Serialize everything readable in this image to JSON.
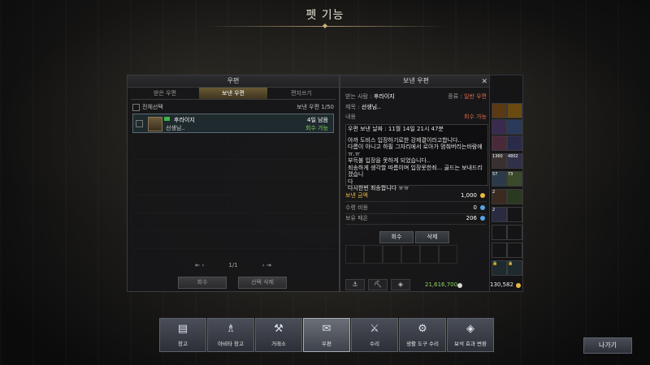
{
  "page_title": "펫 기능",
  "mail_panel": {
    "title": "우편",
    "tabs": [
      {
        "label": "받은 우편"
      },
      {
        "label": "보낸 우편"
      },
      {
        "label": "편지쓰기"
      }
    ],
    "select_all_label": "전체선택",
    "count_label": "보낸 우편 1/50",
    "items": [
      {
        "sender": "후라이지",
        "subject": "선생님..",
        "days_left": "4일 남음",
        "status": "회수 가능"
      }
    ],
    "pager": {
      "prev": "⇤ ‹",
      "page": "1/1",
      "next": "› ⇥"
    },
    "buttons": {
      "recall": "회수",
      "delete_selected": "선택 삭제"
    }
  },
  "detail_panel": {
    "title": "보낸 우편",
    "recipient_label": "받는 사람 :",
    "recipient": "후라이지",
    "type_label": "종류 :",
    "type_value": "일반 우편",
    "subject_label": "제목 :",
    "subject": "선생님..",
    "content_label": "내용",
    "recall_status": "회수 가능",
    "date_line": "우편 보낸 날짜 : 11월 14일 21시 47분",
    "body_lines": [
      "아까 도비스 입장하기로한 강제결이라고합니다..",
      "다름이 아니고 하필 그자리에서 로아가 멈춰버리는바람에 ㅠ.ㅠ",
      "부득불 입장을 못하게 되었습니다..",
      "죄송하게 생각할 따름이며 입장못한죄... 골드는 보내드리겠습니",
      "다",
      "다시한번 죄송합니다 ㅠㅠ"
    ],
    "money": {
      "send_label": "보낸 금액",
      "send_value": "1,000",
      "fee_label": "수령 비용",
      "fee_value": "0",
      "own_label": "보유 패온",
      "own_value": "206"
    },
    "buttons": {
      "recall": "회수",
      "delete": "삭제"
    }
  },
  "inventory": {
    "silver": "21,616,700",
    "gold": "130,582",
    "stacks": [
      "1360",
      "4802",
      "57",
      "73",
      "2",
      "2"
    ]
  },
  "bottom_bar": [
    {
      "label": "창고",
      "icon": "chest-icon"
    },
    {
      "label": "아비타 창고",
      "icon": "avatar-icon"
    },
    {
      "label": "거래소",
      "icon": "gavel-icon"
    },
    {
      "label": "우편",
      "icon": "mail-icon",
      "active": true
    },
    {
      "label": "수리",
      "icon": "anvil-icon"
    },
    {
      "label": "생활 도구 수리",
      "icon": "tool-icon"
    },
    {
      "label": "보석 효과 변환",
      "icon": "gem-icon"
    }
  ],
  "exit_label": "나가기",
  "colors": {
    "accent_gold": "#e2b54a",
    "recall_green": "#7fd25a",
    "active_tab": "#6a5a35"
  }
}
